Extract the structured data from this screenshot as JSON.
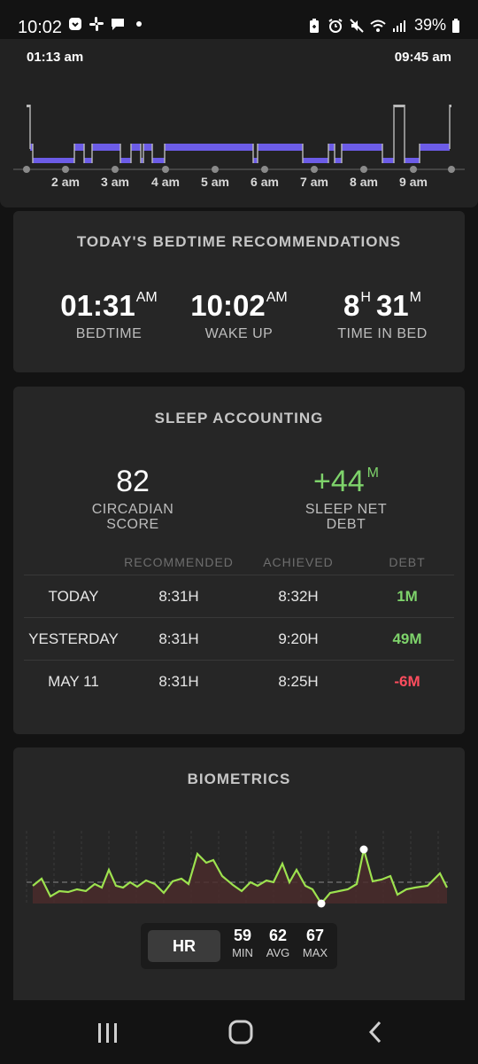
{
  "status_bar": {
    "time": "10:02",
    "battery": "39%",
    "icons": [
      "shield-icon",
      "slack-icon",
      "chat-icon",
      "dot-icon",
      "battery-saver-icon",
      "alarm-icon",
      "mute-icon",
      "wifi-icon",
      "signal-icon",
      "battery-icon"
    ]
  },
  "sleep_graph": {
    "start_time": "01:13 am",
    "end_time": "09:45 am",
    "hour_labels": [
      "2 am",
      "3 am",
      "4 am",
      "5 am",
      "6 am",
      "7 am",
      "8 am",
      "9 am"
    ],
    "accent_color": "#6c5ce7"
  },
  "recommendations": {
    "title": "TODAY'S BEDTIME RECOMMENDATIONS",
    "bedtime": {
      "value": "01:31",
      "suffix": "AM",
      "label": "BEDTIME"
    },
    "wake_up": {
      "value": "10:02",
      "suffix": "AM",
      "label": "WAKE UP"
    },
    "time_in_bed": {
      "hours": "8",
      "hours_unit": "H",
      "minutes": "31",
      "minutes_unit": "M",
      "label": "TIME IN BED"
    }
  },
  "accounting": {
    "title": "SLEEP ACCOUNTING",
    "circadian_score": {
      "value": "82",
      "label_line1": "CIRCADIAN",
      "label_line2": "SCORE"
    },
    "sleep_net_debt": {
      "value": "+44",
      "unit": "M",
      "label_line1": "SLEEP NET",
      "label_line2": "DEBT",
      "color": "#7ed36b"
    },
    "columns": [
      "RECOMMENDED",
      "ACHIEVED",
      "DEBT"
    ],
    "rows": [
      {
        "day": "TODAY",
        "recommended": "8:31H",
        "achieved": "8:32H",
        "debt": "1M",
        "debt_color": "#7ed36b"
      },
      {
        "day": "YESTERDAY",
        "recommended": "8:31H",
        "achieved": "9:20H",
        "debt": "49M",
        "debt_color": "#7ed36b"
      },
      {
        "day": "MAY 11",
        "recommended": "8:31H",
        "achieved": "8:25H",
        "debt": "-6M",
        "debt_color": "#ff4d5e"
      }
    ]
  },
  "biometrics": {
    "title": "BIOMETRICS",
    "metric": "HR",
    "min": {
      "value": "59",
      "label": "MIN"
    },
    "avg": {
      "value": "62",
      "label": "AVG"
    },
    "max": {
      "value": "67",
      "label": "MAX"
    },
    "line_color": "#9de24f",
    "fill_color": "#4a2b2b"
  },
  "nav": {
    "recents": "recent-apps-icon",
    "home": "home-icon",
    "back": "back-icon"
  }
}
